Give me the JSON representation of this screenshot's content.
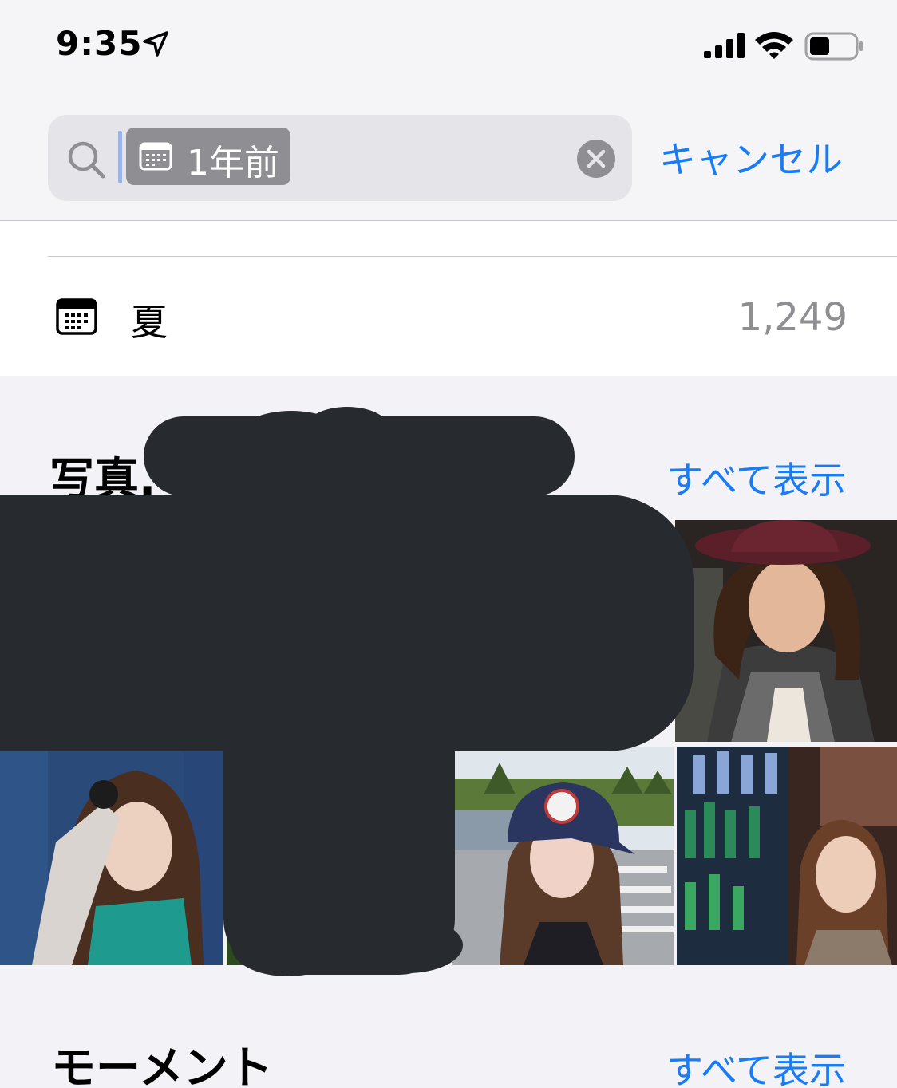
{
  "status_bar": {
    "time": "9:35",
    "icons": [
      "location-arrow-icon",
      "cellular-signal-icon",
      "wifi-icon",
      "battery-icon"
    ]
  },
  "search": {
    "token_label": "1年前",
    "token_icon": "calendar-icon",
    "cancel_label": "キャンセル"
  },
  "results": [
    {
      "icon": "calendar-icon",
      "label": "夏",
      "count": "1,249"
    }
  ],
  "photos_section": {
    "title": "写真.",
    "see_all_label": "すべて表示"
  },
  "moments_section": {
    "title": "モーメント",
    "see_all_label": "すべて表示"
  },
  "colors": {
    "accent": "#1a7cf5",
    "secondary_text": "#8e8e93",
    "redaction": "#272a2e"
  }
}
